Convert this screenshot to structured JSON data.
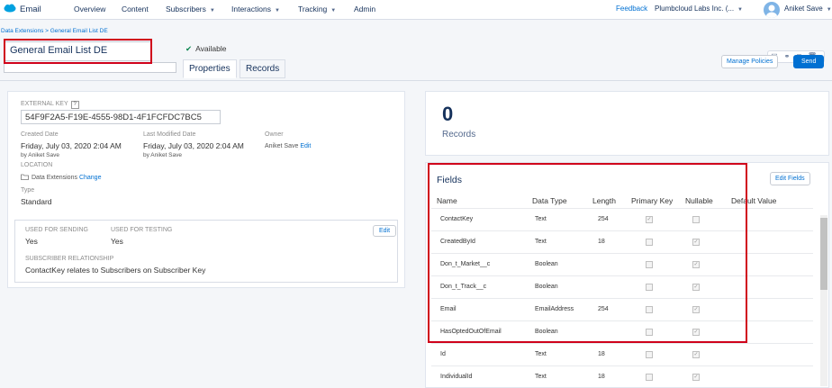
{
  "nav": {
    "app_name": "Email",
    "items": [
      "Overview",
      "Content",
      "Subscribers",
      "Interactions",
      "Tracking",
      "Admin"
    ],
    "feedback": "Feedback",
    "org": "Plumbcloud Labs Inc. (...",
    "user": "Aniket Save"
  },
  "header": {
    "breadcrumb": "Data Extensions > General Email List DE",
    "name_value": "General Email List DE",
    "status": "Available",
    "tabs": [
      "Properties",
      "Records"
    ],
    "manage_policies": "Manage Policies",
    "send": "Send"
  },
  "details": {
    "external_key_label": "EXTERNAL KEY",
    "external_key_help": "?",
    "external_key": "54F9F2A5-F19E-4555-98D1-4F1FCFDC7BC5",
    "created_label": "Created Date",
    "created_date": "Friday, July 03, 2020 2:04 AM",
    "created_by": "by Aniket Save",
    "modified_label": "Last Modified Date",
    "modified_date": "Friday, July 03, 2020 2:04 AM",
    "modified_by": "by Aniket Save",
    "owner_label": "Owner",
    "owner": "Aniket Save",
    "edit_owner": "Edit",
    "location_label": "LOCATION",
    "location": "Data Extensions",
    "change": "Change",
    "type_label": "Type",
    "type": "Standard",
    "sending_label": "USED FOR SENDING",
    "sending": "Yes",
    "testing_label": "USED FOR TESTING",
    "testing": "Yes",
    "edit": "Edit",
    "relationship_label": "SUBSCRIBER RELATIONSHIP",
    "relationship": "ContactKey relates to Subscribers on Subscriber Key"
  },
  "records": {
    "count": "0",
    "label": "Records"
  },
  "fields": {
    "title": "Fields",
    "edit_fields": "Edit Fields",
    "headers": [
      "Name",
      "Data Type",
      "Length",
      "Primary Key",
      "Nullable",
      "Default Value"
    ],
    "rows": [
      {
        "name": "ContactKey",
        "type": "Text",
        "length": "254",
        "primary": true,
        "nullable": false
      },
      {
        "name": "CreatedById",
        "type": "Text",
        "length": "18",
        "primary": false,
        "nullable": true
      },
      {
        "name": "Don_t_Market__c",
        "type": "Boolean",
        "length": "",
        "primary": false,
        "nullable": true
      },
      {
        "name": "Don_t_Track__c",
        "type": "Boolean",
        "length": "",
        "primary": false,
        "nullable": true
      },
      {
        "name": "Email",
        "type": "EmailAddress",
        "length": "254",
        "primary": false,
        "nullable": true
      },
      {
        "name": "HasOptedOutOfEmail",
        "type": "Boolean",
        "length": "",
        "primary": false,
        "nullable": true
      },
      {
        "name": "Id",
        "type": "Text",
        "length": "18",
        "primary": false,
        "nullable": true
      },
      {
        "name": "IndividualId",
        "type": "Text",
        "length": "18",
        "primary": false,
        "nullable": true
      }
    ]
  },
  "colors": {
    "brand": "#0070d2",
    "highlight": "#d0021b",
    "available": "#04844b"
  }
}
